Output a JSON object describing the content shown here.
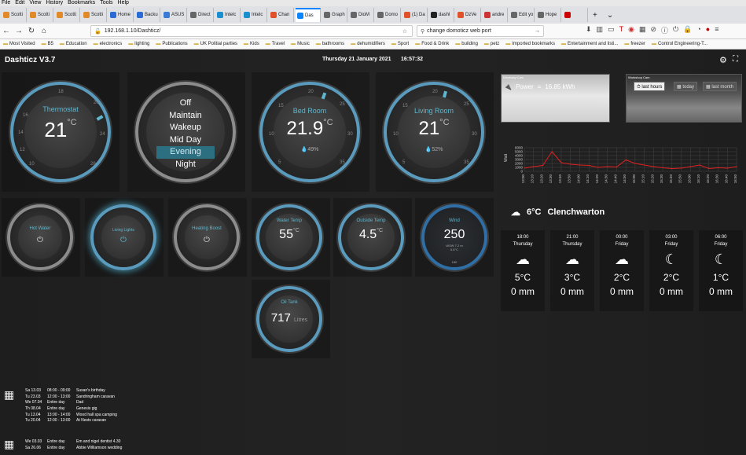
{
  "menubar": [
    "File",
    "Edit",
    "View",
    "History",
    "Bookmarks",
    "Tools",
    "Help"
  ],
  "tabs": [
    {
      "label": "Scotti",
      "color": "#e08a2a"
    },
    {
      "label": "Scotti",
      "color": "#e08a2a"
    },
    {
      "label": "Scotti",
      "color": "#e08a2a"
    },
    {
      "label": "Scotti",
      "color": "#e08a2a"
    },
    {
      "label": "Home",
      "color": "#2a6cd6"
    },
    {
      "label": "Backu",
      "color": "#2a6cd6"
    },
    {
      "label": "ASUS",
      "color": "#3a7bd5"
    },
    {
      "label": "Direct",
      "color": "#666"
    },
    {
      "label": "Intelc",
      "color": "#1a8fd0"
    },
    {
      "label": "Intelc",
      "color": "#1a8fd0"
    },
    {
      "label": "Chan",
      "color": "#e0522a"
    },
    {
      "label": "Das",
      "color": "#0a84ff",
      "active": true
    },
    {
      "label": "Graph",
      "color": "#666"
    },
    {
      "label": "DioM",
      "color": "#666"
    },
    {
      "label": "Domo",
      "color": "#666"
    },
    {
      "label": "(1) Da",
      "color": "#e0522a"
    },
    {
      "label": "dashl",
      "color": "#222"
    },
    {
      "label": "DzVe",
      "color": "#e0522a"
    },
    {
      "label": "andre",
      "color": "#c33"
    },
    {
      "label": "Edit yo",
      "color": "#666"
    },
    {
      "label": "Hope",
      "color": "#666"
    },
    {
      "label": "",
      "color": "#c00"
    }
  ],
  "url": "192.168.1.10/Dashticz/",
  "search_value": "change domoticz web port",
  "bookmarks": [
    "Most Visited",
    "B5",
    "Education",
    "electronics",
    "lighting",
    "Publications",
    "UK Politial parties",
    "Kids",
    "Travel",
    "Music",
    "bathrooms",
    "dehumidifiers",
    "Sport",
    "Food & Drink",
    "building",
    "petz",
    "Imported bookmarks",
    "Entertainment and listi...",
    "freezer",
    "Control Engineering-T..."
  ],
  "dash": {
    "title": "Dashticz V3.7",
    "date": "Thursday 21 January 2021",
    "time": "16:57:32"
  },
  "thermostat": {
    "name": "Thermostat",
    "value": "21",
    "unit": "°C",
    "ticks": [
      "10",
      "12",
      "14",
      "16",
      "18",
      "20",
      "22",
      "24",
      "26"
    ]
  },
  "modes": {
    "items": [
      "Off",
      "Maintain",
      "Wakeup",
      "Mid Day",
      "Evening",
      "Night"
    ],
    "selected": "Evening"
  },
  "bedroom": {
    "name": "Bed Room",
    "value": "21.9",
    "unit": "°C",
    "humidity": "49%",
    "ticks": [
      "5",
      "10",
      "15",
      "20",
      "25",
      "30",
      "35"
    ]
  },
  "livingroom": {
    "name": "Living Room",
    "value": "21",
    "unit": "°C",
    "humidity": "52%",
    "ticks": [
      "5",
      "10",
      "15",
      "20",
      "25",
      "30",
      "35"
    ]
  },
  "switches": [
    {
      "name": "Hot Water",
      "power_icon": "⏻"
    },
    {
      "name": "Living Lights",
      "power_icon": "⏻"
    },
    {
      "name": "Heating Boost",
      "power_icon": "⏻"
    }
  ],
  "water_temp": {
    "name": "Water Temp",
    "value": "55",
    "unit": "°C"
  },
  "outside_temp": {
    "name": "Outside Temp",
    "value": "4.5",
    "unit": "°C"
  },
  "wind": {
    "name": "Wind",
    "value": "250",
    "direction": "WSW",
    "speed": "7.2 m",
    "chill": "5.6°C",
    "scale": "180"
  },
  "oil_tank": {
    "name": "Oil Tank",
    "value": "717",
    "unit": "Litres"
  },
  "cameras": [
    {
      "label": "Driveway Cam"
    },
    {
      "label": "Workshop Cam"
    }
  ],
  "power": {
    "label": "Power",
    "value": "16.85 kWh",
    "buttons": [
      "last hours",
      "today",
      "last month"
    ],
    "selected": "last hours",
    "ylabel": "Watt",
    "chart_data": {
      "type": "line",
      "ylim": [
        0,
        6000
      ],
      "yticks": [
        0,
        1000,
        2000,
        3000,
        4000,
        5000,
        6000
      ],
      "categories": [
        "13:00",
        "13:10",
        "13:20",
        "13:30",
        "13:40",
        "13:50",
        "14:00",
        "14:10",
        "14:20",
        "14:30",
        "14:40",
        "14:50",
        "15:00",
        "15:10",
        "15:20",
        "15:30",
        "15:40",
        "15:50",
        "16:00",
        "16:10",
        "16:20",
        "16:30",
        "16:40",
        "16:50"
      ],
      "values": [
        800,
        1200,
        1500,
        5000,
        2200,
        1800,
        1600,
        1500,
        1000,
        1200,
        1100,
        2900,
        2000,
        1600,
        1200,
        900,
        700,
        800,
        1200,
        1600,
        700,
        900,
        800,
        1200
      ],
      "grid": true
    }
  },
  "weather": {
    "now_temp": "6°C",
    "location": "Clenchwarton",
    "forecast": [
      {
        "time": "18:00",
        "day": "Thursday",
        "icon": "cloud",
        "temp": "5°C",
        "rain": "0 mm"
      },
      {
        "time": "21:00",
        "day": "Thursday",
        "icon": "cloud",
        "temp": "3°C",
        "rain": "0 mm"
      },
      {
        "time": "00:00",
        "day": "Friday",
        "icon": "cloud",
        "temp": "2°C",
        "rain": "0 mm"
      },
      {
        "time": "03:00",
        "day": "Friday",
        "icon": "moon",
        "temp": "2°C",
        "rain": "0 mm"
      },
      {
        "time": "06:00",
        "day": "Friday",
        "icon": "moon",
        "temp": "1°C",
        "rain": "0 mm"
      }
    ]
  },
  "calendar1": [
    [
      "Sa 13.03",
      "08:00 - 09:00",
      "Susan's birthday"
    ],
    [
      "Tu 23.03",
      "12:00 - 13:00",
      "Sandringham caravan"
    ],
    [
      "We 07.04",
      "Entire day",
      "Dad"
    ],
    [
      "Th 08.04",
      "Entire day",
      "Genesis gig"
    ],
    [
      "Tu 13.04",
      "13:00 - 14:00",
      "Wood hall spa camping"
    ],
    [
      "Tu 20.04",
      "12:00 - 13:00",
      "At Nests caravan"
    ]
  ],
  "calendar2": [
    [
      "We 03.03",
      "Entire day",
      "Em and nigel dentist 4.30"
    ],
    [
      "Sa 26.06",
      "Entire day",
      "Abbie Williamson wedding"
    ]
  ]
}
